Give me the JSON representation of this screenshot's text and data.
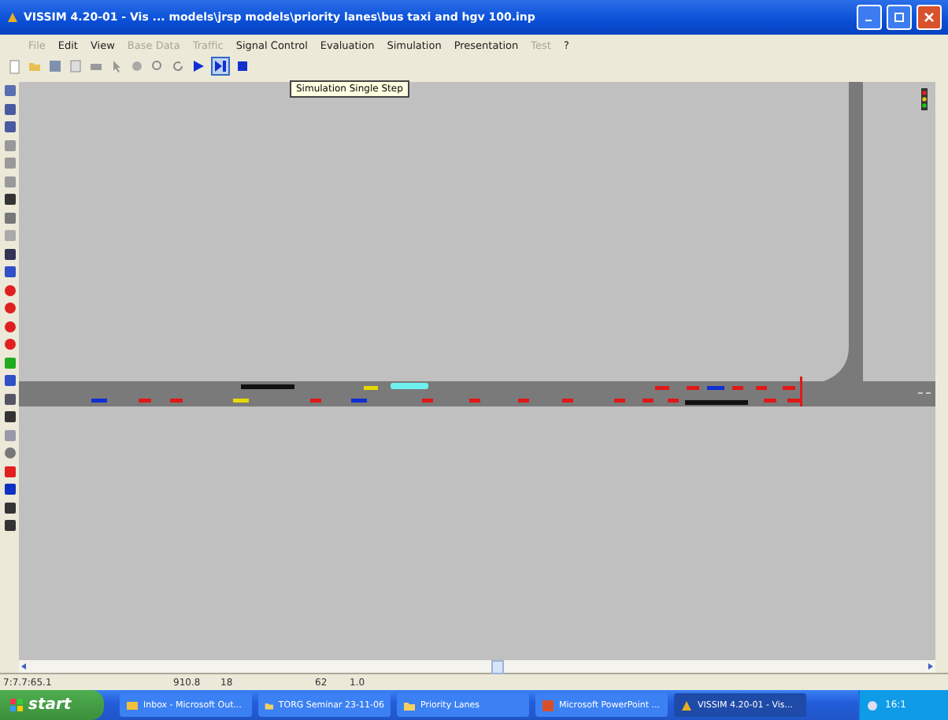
{
  "window": {
    "title": "VISSIM 4.20-01 - Vis ... models\\jrsp models\\priority lanes\\bus taxi and hgv 100.inp"
  },
  "menu": [
    {
      "label": "File",
      "disabled": true
    },
    {
      "label": "Edit",
      "disabled": false
    },
    {
      "label": "View",
      "disabled": false
    },
    {
      "label": "Base Data",
      "disabled": true
    },
    {
      "label": "Traffic",
      "disabled": true
    },
    {
      "label": "Signal Control",
      "disabled": false
    },
    {
      "label": "Evaluation",
      "disabled": false
    },
    {
      "label": "Simulation",
      "disabled": false
    },
    {
      "label": "Presentation",
      "disabled": false
    },
    {
      "label": "Test",
      "disabled": true
    },
    {
      "label": "?",
      "disabled": false
    }
  ],
  "tooltip": "Simulation Single Step",
  "status_bar": [
    "7:7.7:65.1",
    "910.8",
    "18",
    "62",
    "1.0"
  ],
  "taskbar": {
    "start": "start",
    "tasks": [
      {
        "label": "Inbox - Microsoft Out...",
        "kind": "mail",
        "selected": false
      },
      {
        "label": "TORG Seminar 23-11-06",
        "kind": "folder",
        "selected": false
      },
      {
        "label": "Priority Lanes",
        "kind": "folder",
        "selected": false
      },
      {
        "label": "Microsoft PowerPoint ...",
        "kind": "powerpoint",
        "selected": false
      },
      {
        "label": "VISSIM 4.20-01 - Vis...",
        "kind": "app",
        "selected": true
      }
    ],
    "clock": "16:1"
  }
}
